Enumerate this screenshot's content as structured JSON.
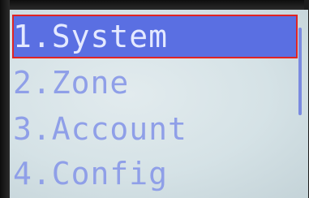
{
  "menu": {
    "items": [
      {
        "label": "1.System",
        "selected": true
      },
      {
        "label": "2.Zone",
        "selected": false
      },
      {
        "label": "3.Account",
        "selected": false
      },
      {
        "label": "4.Config",
        "selected": false
      }
    ]
  },
  "colors": {
    "screen_background": "#d5e2e6",
    "item_text": "#8f9fe8",
    "selected_background": "#5a6fe2",
    "selected_text": "#e4e9ff",
    "selection_border": "#e02424",
    "scrollbar": "#7a8ae0"
  }
}
